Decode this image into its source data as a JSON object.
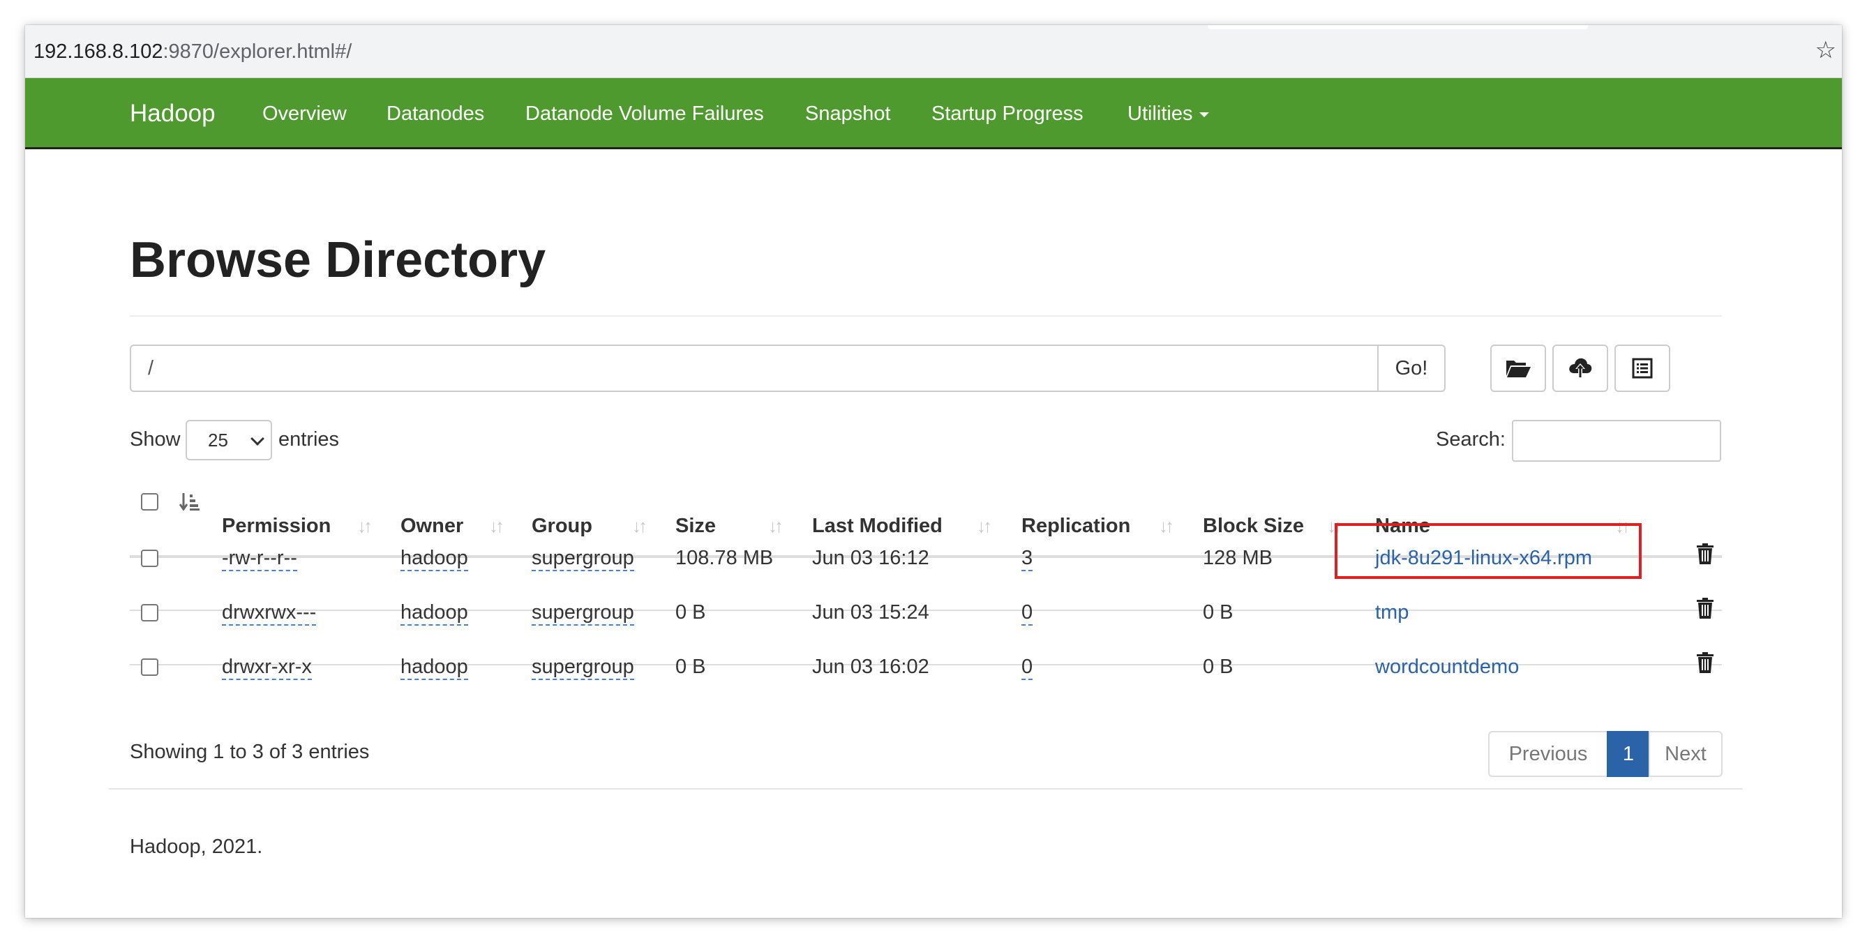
{
  "browser": {
    "url_host": "192.168.8.102",
    "url_rest": ":9870/explorer.html#/",
    "star_icon": "☆"
  },
  "navbar": {
    "brand": "Hadoop",
    "items": [
      {
        "label": "Overview"
      },
      {
        "label": "Datanodes"
      },
      {
        "label": "Datanode Volume Failures"
      },
      {
        "label": "Snapshot"
      },
      {
        "label": "Startup Progress"
      },
      {
        "label": "Utilities"
      }
    ],
    "color": "#4f9a2e"
  },
  "page": {
    "title": "Browse Directory",
    "path_value": "/",
    "go_label": "Go!",
    "icons": [
      "folder-open-icon",
      "cloud-upload-icon",
      "list-alt-icon"
    ]
  },
  "controls": {
    "show_label": "Show",
    "entries_value": "25",
    "entries_label": "entries",
    "search_label": "Search:"
  },
  "table": {
    "columns": [
      "Permission",
      "Owner",
      "Group",
      "Size",
      "Last Modified",
      "Replication",
      "Block Size",
      "Name"
    ],
    "rows": [
      {
        "permission": "-rw-r--r--",
        "owner": "hadoop",
        "group": "supergroup",
        "size": "108.78 MB",
        "modified": "Jun 03 16:12",
        "replication": "3",
        "block_size": "128 MB",
        "name": "jdk-8u291-linux-x64.rpm",
        "highlighted": true
      },
      {
        "permission": "drwxrwx---",
        "owner": "hadoop",
        "group": "supergroup",
        "size": "0 B",
        "modified": "Jun 03 15:24",
        "replication": "0",
        "block_size": "0 B",
        "name": "tmp",
        "highlighted": false
      },
      {
        "permission": "drwxr-xr-x",
        "owner": "hadoop",
        "group": "supergroup",
        "size": "0 B",
        "modified": "Jun 03 16:02",
        "replication": "0",
        "block_size": "0 B",
        "name": "wordcountdemo",
        "highlighted": false
      }
    ]
  },
  "pagination": {
    "info": "Showing 1 to 3 of 3 entries",
    "previous": "Previous",
    "current": "1",
    "next": "Next",
    "accent": "#2a63a8"
  },
  "footer": {
    "text": "Hadoop, 2021."
  },
  "highlight_color": "#e02020"
}
